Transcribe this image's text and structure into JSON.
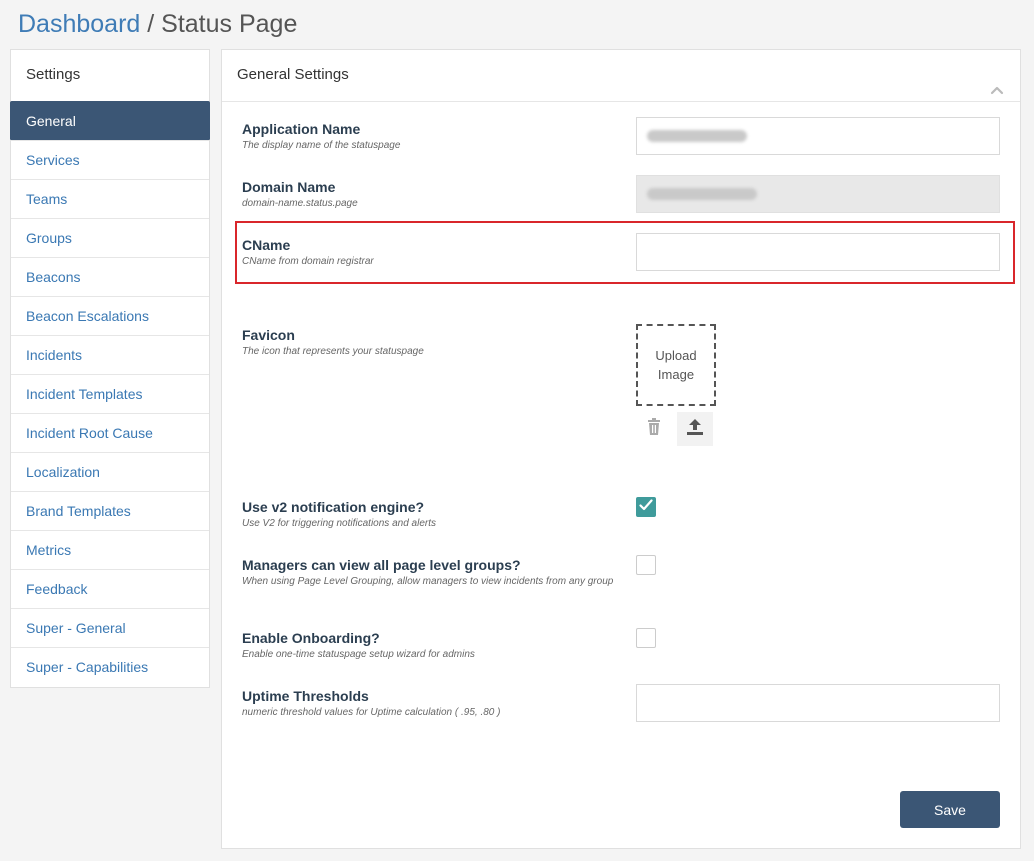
{
  "breadcrumb": {
    "root": "Dashboard",
    "separator": " / ",
    "current": "Status Page"
  },
  "sidebar": {
    "header": "Settings",
    "items": [
      {
        "label": "General",
        "active": true
      },
      {
        "label": "Services"
      },
      {
        "label": "Teams"
      },
      {
        "label": "Groups"
      },
      {
        "label": "Beacons"
      },
      {
        "label": "Beacon Escalations"
      },
      {
        "label": "Incidents"
      },
      {
        "label": "Incident Templates"
      },
      {
        "label": "Incident Root Cause"
      },
      {
        "label": "Localization"
      },
      {
        "label": "Brand Templates"
      },
      {
        "label": "Metrics"
      },
      {
        "label": "Feedback"
      },
      {
        "label": "Super - General"
      },
      {
        "label": "Super - Capabilities"
      }
    ]
  },
  "panel": {
    "title": "General Settings",
    "fields": {
      "app_name": {
        "label": "Application Name",
        "help": "The display name of the statuspage"
      },
      "domain_name": {
        "label": "Domain Name",
        "help": "domain-name.status.page"
      },
      "cname": {
        "label": "CName",
        "help": "CName from domain registrar",
        "value": ""
      },
      "favicon": {
        "label": "Favicon",
        "help": "The icon that represents your statuspage",
        "upload_label": "Upload Image"
      },
      "v2_engine": {
        "label": "Use v2 notification engine?",
        "help": "Use V2 for triggering notifications and alerts",
        "checked": true
      },
      "managers_view": {
        "label": "Managers can view all page level groups?",
        "help": "When using Page Level Grouping, allow managers to view incidents from any group",
        "checked": false
      },
      "onboarding": {
        "label": "Enable Onboarding?",
        "help": "Enable one-time statuspage setup wizard for admins",
        "checked": false
      },
      "uptime": {
        "label": "Uptime Thresholds",
        "help": "numeric threshold values for Uptime calculation ( .95, .80 )",
        "value": ""
      }
    },
    "save_label": "Save"
  },
  "colors": {
    "accent": "#3b5675",
    "link": "#3a78b3",
    "check": "#3f9b9b",
    "highlight": "#d9262b"
  },
  "icons": {
    "collapse": "chevron-up-icon",
    "trash": "trash-icon",
    "upload": "upload-icon",
    "check": "check-icon"
  }
}
